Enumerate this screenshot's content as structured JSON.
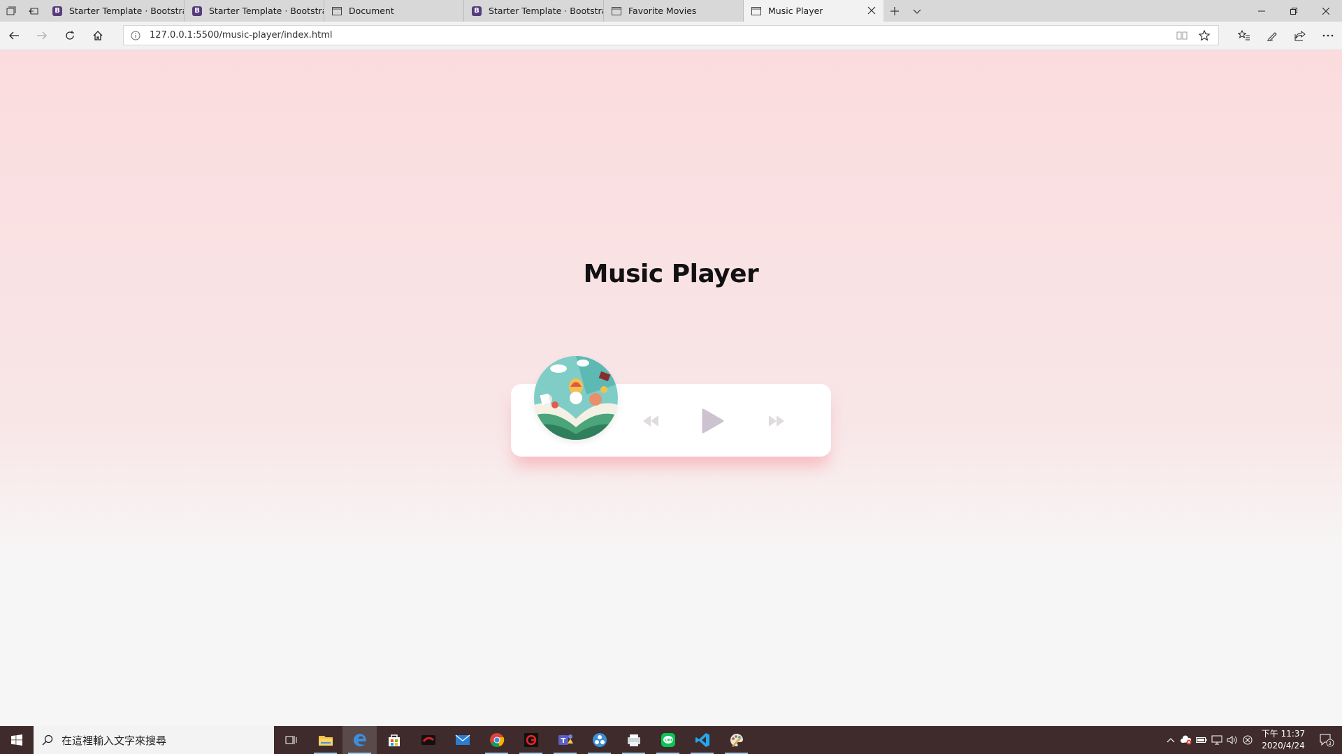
{
  "browser": {
    "tabs": [
      {
        "title": "Starter Template · Bootstrap",
        "favicon": "bootstrap-b",
        "active": false
      },
      {
        "title": "Starter Template · Bootstrap",
        "favicon": "bootstrap-b",
        "active": false
      },
      {
        "title": "Document",
        "favicon": "page-icon",
        "active": false
      },
      {
        "title": "Starter Template · Bootstrap",
        "favicon": "bootstrap-b",
        "active": false
      },
      {
        "title": "Favorite Movies",
        "favicon": "page-icon",
        "active": false
      },
      {
        "title": "Music Player",
        "favicon": "page-icon",
        "active": true
      }
    ],
    "favicon_letter": "B",
    "url": "127.0.0.1:5500/music-player/index.html"
  },
  "page": {
    "title": "Music Player",
    "accent": "#f7999f",
    "player": {
      "controls": [
        "prev-icon",
        "play-icon",
        "next-icon"
      ],
      "control_color": "#dfdbdf",
      "play_color": "#cdc2d0"
    }
  },
  "taskbar": {
    "search_placeholder": "在這裡輸入文字來搜尋",
    "apps": [
      "task-view-icon",
      "file-explorer-icon",
      "edge-icon",
      "store-icon",
      "game-app-icon",
      "mail-icon",
      "chrome-icon",
      "red-app-icon",
      "teams-icon",
      "photos-app-icon",
      "printer-app-icon",
      "line-icon",
      "vscode-icon",
      "paint-icon"
    ],
    "clock_time": "下午 11:37",
    "clock_date": "2020/4/24",
    "notification_count": "3"
  }
}
